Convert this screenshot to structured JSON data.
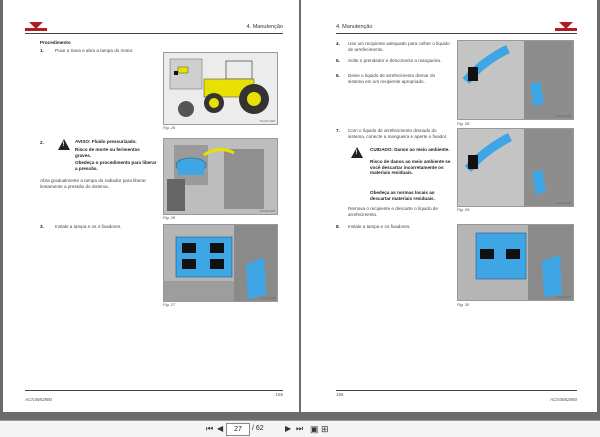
{
  "left_page": {
    "section_header": "4. Manutenção",
    "heading": "Procedimento",
    "step1_num": "1.",
    "step1_text": "Puxe a trava e abra a tampa do motor.",
    "fig25_caption": "Fig. 25",
    "fig25_ref": "TILL001-0084",
    "step2_num": "2.",
    "warn_title": "AVISO: Fluido pressurizado.",
    "warn_line1": "Risco de morte ou ferimentos graves.",
    "warn_line2": "Obedeça o procedimento para liberar a pressão.",
    "step2_body": "Abra gradualmente a tampa do radiador para liberar lentamente a pressão do sistema.",
    "fig26_caption": "Fig. 26",
    "fig26_ref": "TILL001-0081",
    "step3_num": "3.",
    "step3_text": "Instale a tampa e os 4 fixadores.",
    "fig27_caption": "Fig. 27",
    "fig27_ref": "TILL001-0088",
    "footer_code": "ACN3682880",
    "page_number": "155"
  },
  "right_page": {
    "section_header": "4. Manutenção",
    "step4_num": "4.",
    "step4_text": "Use um recipiente adequado para colher o líquido de arrefecimento.",
    "step5_num": "5.",
    "step5_text": "Solte o prendedor e desconecte a mangueira.",
    "step6_num": "6.",
    "step6_text": "Deixe o líquido de arrefecimento drenar do sistema em um recipiente apropriado.",
    "fig28a_caption": "Fig. 28",
    "fig28a_ref": "TILL001-0089",
    "step7_num": "7.",
    "step7_text": "Com o líquido de arrefecimento drenado do sistema, conecte a mangueira e aperte o fixador.",
    "caution_title": "CUIDADO: Danos ao meio ambiente.",
    "caution_line1": "Risco de danos ao meio ambiente se você descartar incorretamente os materiais residuais.",
    "caution_line2": "Obedeça as normas locais ao descartar materiais residuais.",
    "step7_body": "Remova o recipiente e descarte o líquido de arrefecimento.",
    "fig29_caption": "Fig. 29",
    "fig29_ref": "TILL001-0090",
    "step8_num": "8.",
    "step8_text": "Instale a tampa e os fixadores.",
    "fig30_caption": "Fig. 30",
    "fig30_ref": "TILL001-0091",
    "footer_code": "ACN3682880",
    "page_number": "156"
  },
  "toolbar": {
    "first_icon": "first-page-icon",
    "prev_icon": "prev-page-icon",
    "current_page": "27",
    "page_separator": "/",
    "total_pages": "62",
    "next_icon": "next-page-icon",
    "last_icon": "last-page-icon",
    "fit_page_icon": "fit-page-icon",
    "fit_width_icon": "fit-width-icon"
  },
  "colors": {
    "brand_red": "#b01c24",
    "highlight_blue": "#3fa6e6",
    "highlight_yellow": "#e8e000",
    "background": "#6b6b6b"
  }
}
